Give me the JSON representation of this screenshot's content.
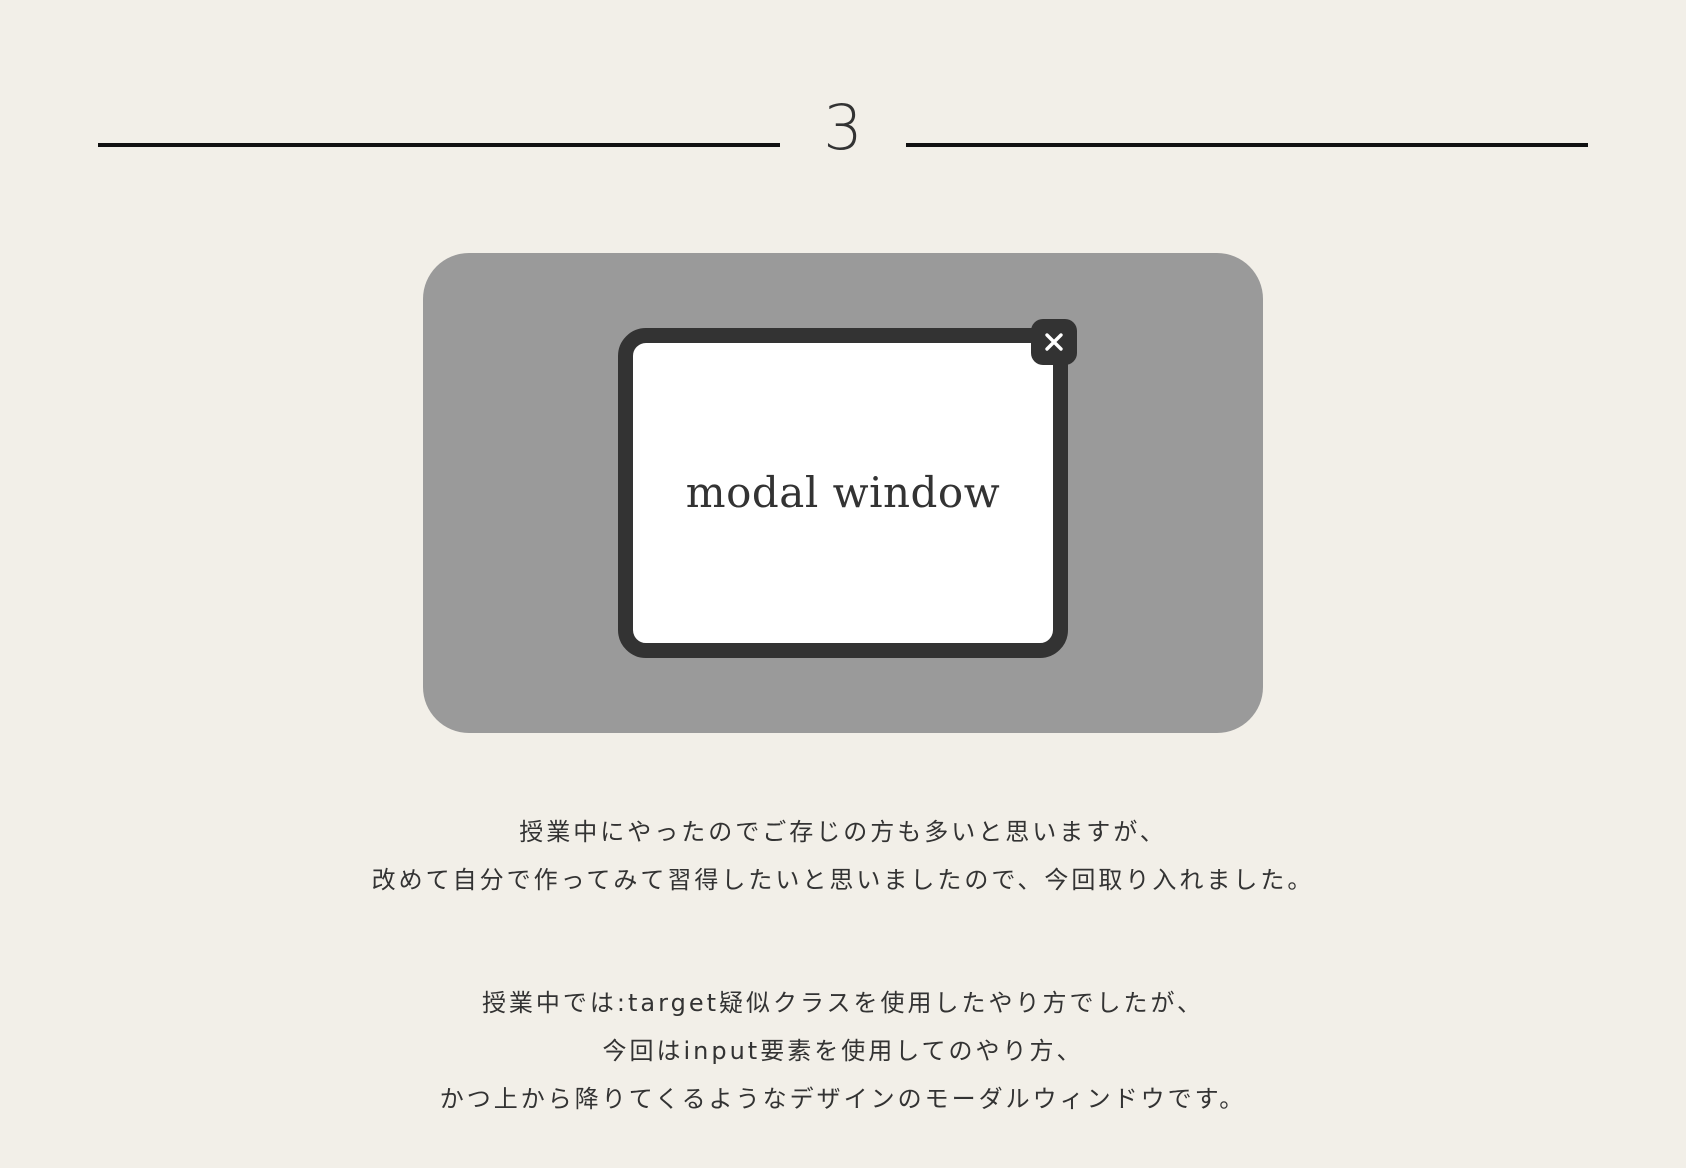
{
  "header": {
    "section_number": "3"
  },
  "demo": {
    "modal_title": "modal window",
    "close_icon": "close-icon"
  },
  "description": {
    "paragraph1": [
      "授業中にやったのでご存じの方も多いと思いますが、",
      "改めて自分で作ってみて習得したいと思いましたので、今回取り入れました。"
    ],
    "paragraph2": [
      "授業中では:target疑似クラスを使用したやり方でしたが、",
      "今回はinput要素を使用してのやり方、",
      "かつ上から降りてくるようなデザインのモーダルウィンドウです。"
    ]
  },
  "colors": {
    "background": "#f2efe8",
    "panel": "#9a9a9a",
    "modal_border": "#333333",
    "modal_background": "#ffffff",
    "text": "#333333",
    "rule": "#111111"
  }
}
